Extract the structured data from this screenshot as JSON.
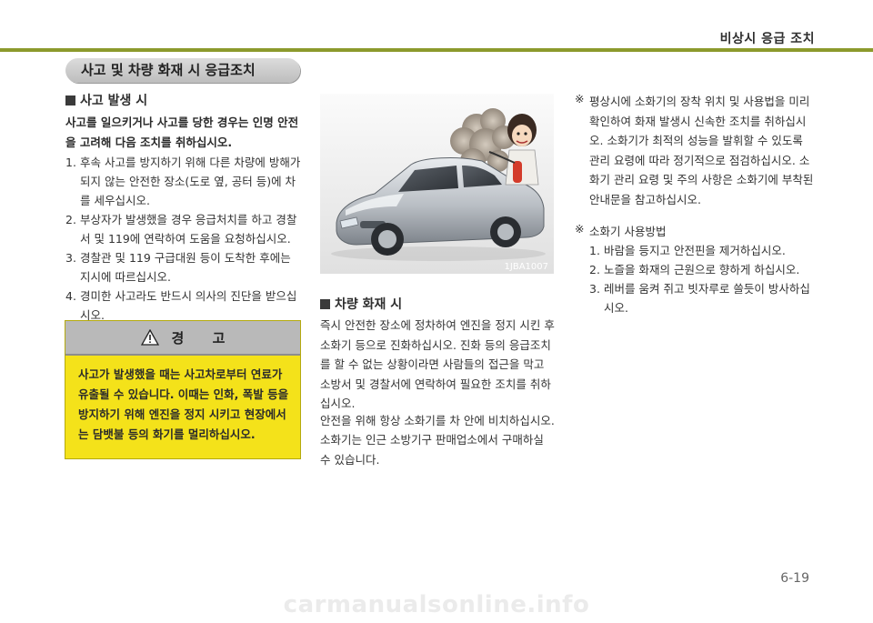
{
  "header": {
    "title": "비상시 응급 조치"
  },
  "section": {
    "title": "사고 및 차량 화재 시 응급조치"
  },
  "accident": {
    "heading": "사고 발생 시",
    "intro": "사고를 일으키거나 사고를 당한 경우는 인명 안전을 고려해 다음 조치를 취하십시오.",
    "items": [
      {
        "n": "1.",
        "text": "후속 사고를 방지하기 위해 다른 차량에 방해가 되지 않는 안전한 장소(도로 옆, 공터 등)에 차를 세우십시오."
      },
      {
        "n": "2.",
        "text": "부상자가 발생했을 경우 응급처치를 하고 경찰서 및 119에 연락하여 도움을 요청하십시오."
      },
      {
        "n": "3.",
        "text": "경찰관 및 119 구급대원 등이 도착한 후에는 지시에 따르십시오."
      },
      {
        "n": "4.",
        "text": "경미한 사고라도 반드시 의사의 진단을 받으십시오."
      }
    ]
  },
  "warning": {
    "title": "경      고",
    "text": "사고가 발생했을 때는 사고차로부터 연료가 유출될 수 있습니다. 이때는 인화, 폭발 등을 방지하기 위해 엔진을 정지 시키고 현장에서는 담뱃불 등의 화기를 멀리하십시오."
  },
  "figure": {
    "code": "1JBA1007",
    "icon": "car-on-fire-illustration"
  },
  "fire": {
    "heading": "차량 화재 시",
    "p1": "즉시 안전한 장소에 정차하여 엔진을 정지 시킨 후 소화기 등으로 진화하십시오. 진화 등의 응급조치를 할 수 없는 상황이라면 사람들의 접근을 막고 소방서 및 경찰서에 연락하여 필요한 조치를 취하십시오.",
    "p2": "안전을 위해 항상 소화기를 차 안에 비치하십시오.",
    "p3": "소화기는 인근 소방기구 판매업소에서 구매하실 수 있습니다."
  },
  "notes": {
    "mark": "※",
    "note1": "평상시에 소화기의 장착 위치 및 사용법을 미리 확인하여 화재 발생시 신속한 조치를 취하십시오. 소화기가 최적의 성능을 발휘할 수 있도록 관리 요령에 따라 정기적으로 점검하십시오. 소화기 관리 요령 및 주의 사항은 소화기에 부착된 안내문을 참고하십시오.",
    "note2_title": "소화기 사용방법",
    "steps": [
      {
        "n": "1.",
        "text": "바람을 등지고 안전핀을 제거하십시오."
      },
      {
        "n": "2.",
        "text": "노즐을 화재의 근원으로 향하게 하십시오."
      },
      {
        "n": "3.",
        "text": "레버를 움켜 쥐고 빗자루로 쓸듯이 방사하십시오."
      }
    ]
  },
  "page_number": "6-19",
  "watermark": "carmanualsonline.info",
  "colors": {
    "header_rule": "#8c9a2c",
    "warning_bg": "#f4e21a",
    "warning_head": "#b9b9b9"
  }
}
